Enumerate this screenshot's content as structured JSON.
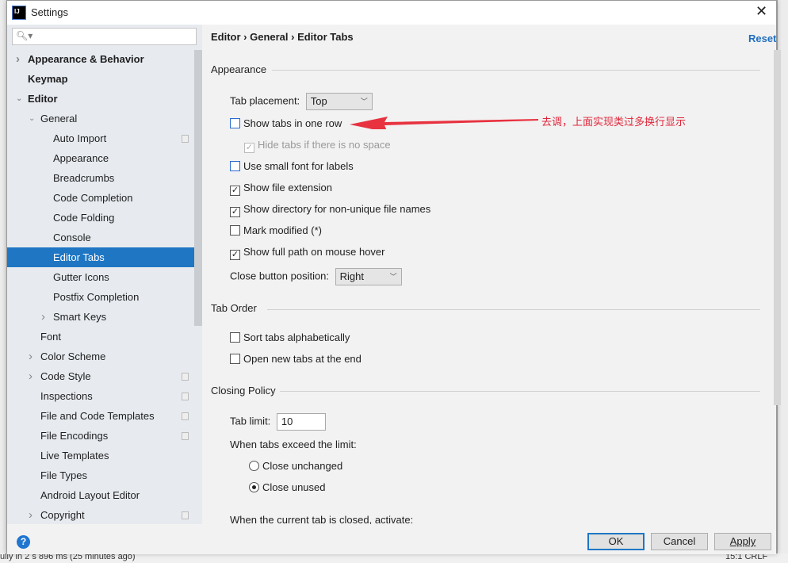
{
  "window": {
    "title": "Settings",
    "logo_text": "IJ"
  },
  "background_status": {
    "left": "ully in 2 s 896 ms (25 minutes ago)",
    "right": "15:1   CRLF"
  },
  "sidebar": {
    "search_placeholder": "",
    "items": [
      {
        "label": "Appearance & Behavior",
        "level": 0,
        "arrow": "right",
        "bold": true
      },
      {
        "label": "Keymap",
        "level": 0,
        "bold": true
      },
      {
        "label": "Editor",
        "level": 0,
        "arrow": "down",
        "bold": true
      },
      {
        "label": "General",
        "level": 1,
        "arrow": "down"
      },
      {
        "label": "Auto Import",
        "level": 2,
        "copy": true
      },
      {
        "label": "Appearance",
        "level": 2
      },
      {
        "label": "Breadcrumbs",
        "level": 2
      },
      {
        "label": "Code Completion",
        "level": 2
      },
      {
        "label": "Code Folding",
        "level": 2
      },
      {
        "label": "Console",
        "level": 2
      },
      {
        "label": "Editor Tabs",
        "level": 2,
        "selected": true
      },
      {
        "label": "Gutter Icons",
        "level": 2
      },
      {
        "label": "Postfix Completion",
        "level": 2
      },
      {
        "label": "Smart Keys",
        "level": 2,
        "arrow": "right"
      },
      {
        "label": "Font",
        "level": 1
      },
      {
        "label": "Color Scheme",
        "level": 1,
        "arrow": "right"
      },
      {
        "label": "Code Style",
        "level": 1,
        "arrow": "right",
        "copy": true
      },
      {
        "label": "Inspections",
        "level": 1,
        "copy": true
      },
      {
        "label": "File and Code Templates",
        "level": 1,
        "copy": true
      },
      {
        "label": "File Encodings",
        "level": 1,
        "copy": true
      },
      {
        "label": "Live Templates",
        "level": 1
      },
      {
        "label": "File Types",
        "level": 1
      },
      {
        "label": "Android Layout Editor",
        "level": 1
      },
      {
        "label": "Copyright",
        "level": 1,
        "arrow": "right",
        "copy": true
      }
    ]
  },
  "main": {
    "breadcrumb": "Editor  ›  General  ›  Editor Tabs",
    "reset": "Reset",
    "appearance": {
      "header": "Appearance",
      "tab_placement_label": "Tab placement:",
      "tab_placement_value": "Top",
      "show_one_row": {
        "label": "Show tabs in one row",
        "checked": false
      },
      "hide_no_space": {
        "label": "Hide tabs if there is no space",
        "checked": true,
        "disabled": true
      },
      "small_font": {
        "label": "Use small font for labels",
        "checked": false
      },
      "file_ext": {
        "label": "Show file extension",
        "checked": true
      },
      "dir_nonunique": {
        "label": "Show directory for non-unique file names",
        "checked": true
      },
      "mark_modified": {
        "label": "Mark modified (*)",
        "checked": false
      },
      "full_path": {
        "label": "Show full path on mouse hover",
        "checked": true
      },
      "close_btn_label": "Close button position:",
      "close_btn_value": "Right"
    },
    "tab_order": {
      "header": "Tab Order",
      "sort": {
        "label": "Sort tabs alphabetically",
        "checked": false
      },
      "open_end": {
        "label": "Open new tabs at the end",
        "checked": false
      }
    },
    "closing": {
      "header": "Closing Policy",
      "limit_label": "Tab limit:",
      "limit_value": "10",
      "exceed_label": "When tabs exceed the limit:",
      "close_unchanged": "Close unchanged",
      "close_unused": "Close unused",
      "selected": "Close unused",
      "activate_label": "When the current tab is closed, activate:"
    },
    "annotation": "去调，上面实现类过多换行显示",
    "annotation_color": "#e0263a"
  },
  "footer": {
    "ok": "OK",
    "cancel": "Cancel",
    "apply": "Apply"
  },
  "colors": {
    "selection": "#1f76c3",
    "link": "#1f6fbf"
  }
}
